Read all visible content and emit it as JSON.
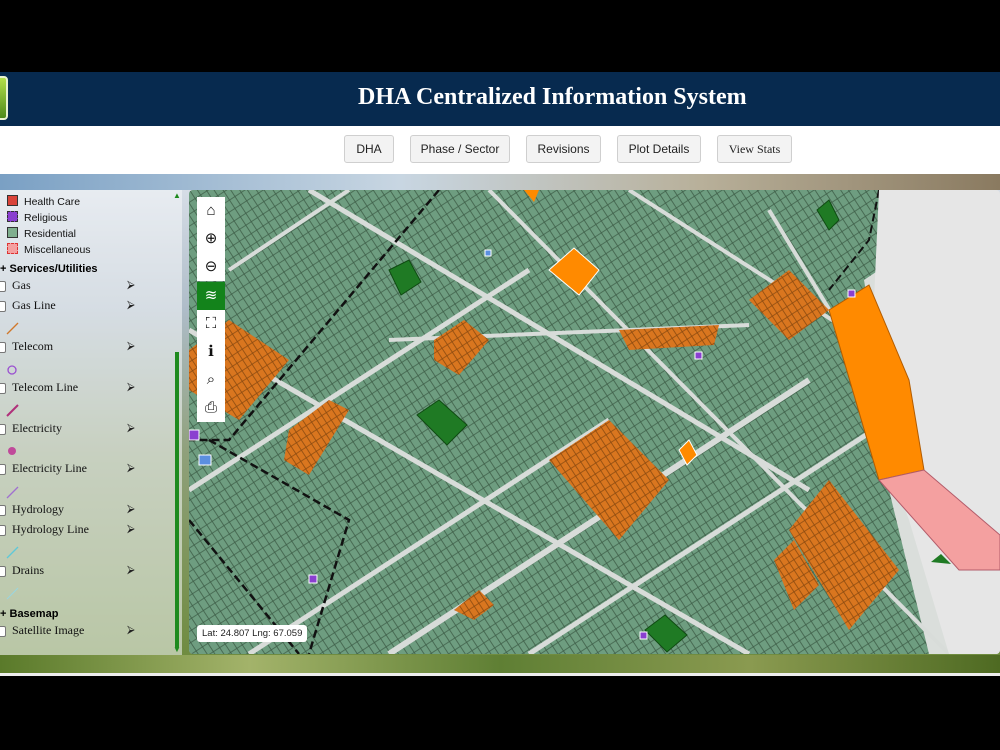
{
  "header": {
    "title": "DHA Centralized Information System"
  },
  "nav": [
    "DHA",
    "Phase / Sector",
    "Revisions",
    "Plot Details",
    "View Stats"
  ],
  "legend": [
    {
      "label": "Health Care",
      "color": "#d9433a"
    },
    {
      "label": "Religious",
      "color": "#8a3fd0"
    },
    {
      "label": "Residential",
      "color": "#7fae8e"
    },
    {
      "label": "Miscellaneous",
      "color": "#f4a0a0"
    }
  ],
  "sections": {
    "services": "Services/Utilities",
    "basemap": "Basemap"
  },
  "layers": [
    {
      "label": "Gas",
      "checked": false
    },
    {
      "label": "Gas Line",
      "checked": false
    },
    {
      "label": "Telecom",
      "checked": false
    },
    {
      "label": "Telecom Line",
      "checked": false
    },
    {
      "label": "Electricity",
      "checked": false
    },
    {
      "label": "Electricity Line",
      "checked": false
    },
    {
      "label": "Hydrology",
      "checked": false
    },
    {
      "label": "Hydrology Line",
      "checked": false
    },
    {
      "label": "Drains",
      "checked": false
    },
    {
      "label": "Satellite Image",
      "checked": false
    }
  ],
  "toolbar": [
    "home-icon",
    "zoom-in-icon",
    "zoom-out-icon",
    "layers-icon",
    "area-select-icon",
    "info-icon",
    "search-icon",
    "print-icon"
  ],
  "map": {
    "coords_label": "Lat: 24.807 Lng: 67.059",
    "colors": {
      "residential": "#6e9d80",
      "road": "#d8dcd9",
      "commercial": "#e07820",
      "park": "#1f7a24",
      "amenity": "#f4a0a0",
      "orange": "#ff8a00"
    }
  },
  "icons": {
    "home": "⌂",
    "zoom_in": "⊕",
    "zoom_out": "⊖",
    "layers": "≋",
    "area": "⛶",
    "info": "ℹ",
    "search": "⌕",
    "print": "⎙",
    "forward": "⮚",
    "plus": "+"
  }
}
